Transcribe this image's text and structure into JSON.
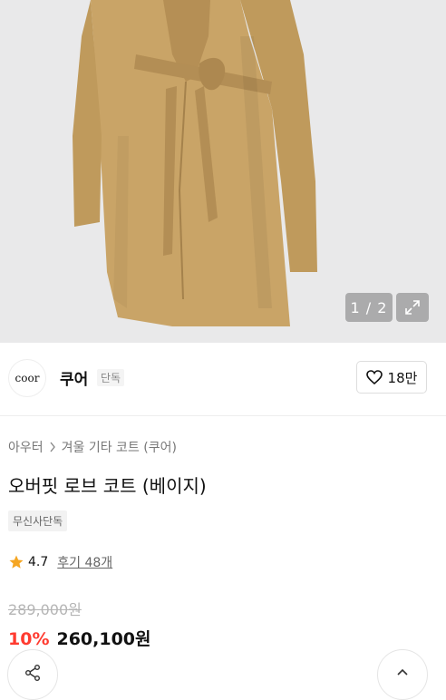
{
  "hero": {
    "image_alt": "coat product image",
    "counter": "1 / 2",
    "expand_icon": "expand-icon"
  },
  "brand": {
    "logo_text": "coor",
    "name": "쿠어",
    "exclusive_label": "단독"
  },
  "like": {
    "icon": "heart-icon",
    "count": "18만"
  },
  "breadcrumb": {
    "items": [
      "아우터",
      "겨울 기타 코트 (쿠어)"
    ],
    "separator_icon": "chevron-right-icon"
  },
  "product": {
    "title": "오버핏 로브 코트 (베이지)",
    "badge": "무신사단독",
    "rating": "4.7",
    "review_label": "후기 48개",
    "original_price": "289,000원",
    "discount": "10%",
    "final_price": "260,100원"
  },
  "colors": {
    "coat": "#c9a467",
    "background": "#e9e9ea",
    "star": "#f5a623",
    "discount": "#ff3b30"
  }
}
